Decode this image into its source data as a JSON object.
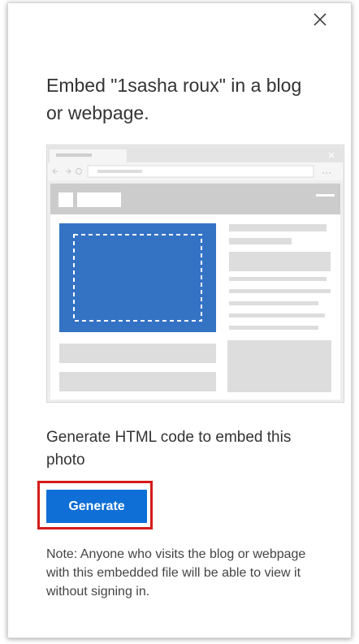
{
  "dialog": {
    "title": "Embed \"1sasha roux\" in a blog or webpage.",
    "close_icon": "close-icon",
    "illustration": "embed-webpage-illustration",
    "description": "Generate HTML code to embed this photo",
    "generate_label": "Generate",
    "note": "Note: Anyone who visits the blog or webpage with this embedded file will be able to view it without signing in."
  },
  "colors": {
    "accent": "#0f6fd6",
    "highlight": "#d51a1a",
    "illustration_photo": "#3473c4"
  }
}
